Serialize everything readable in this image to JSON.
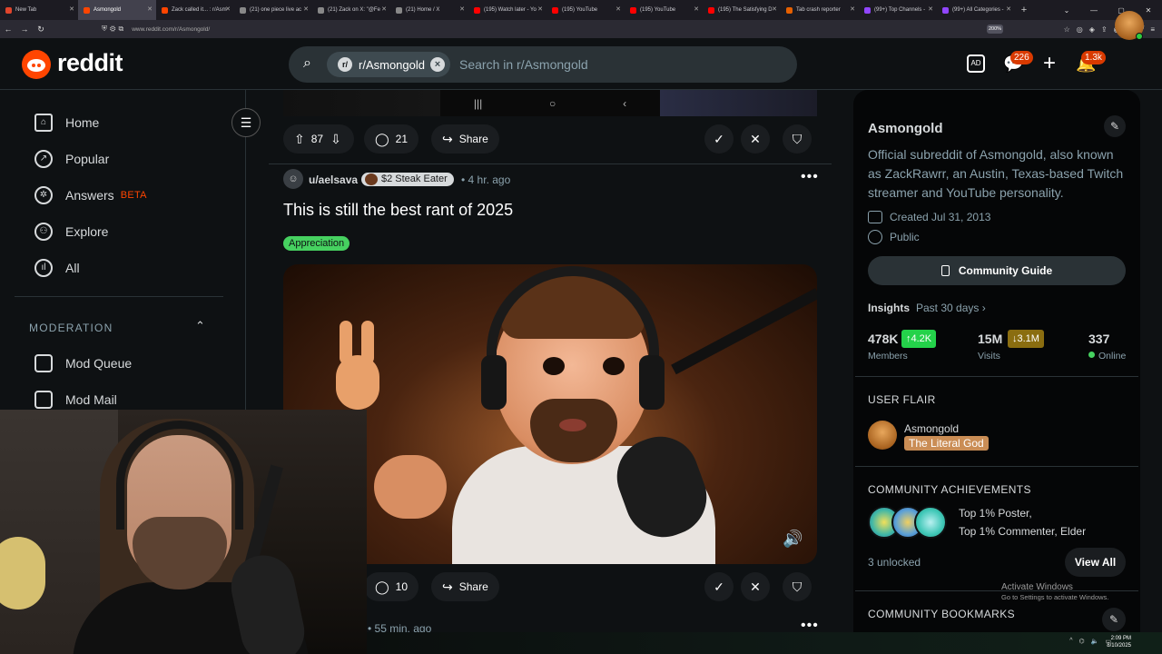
{
  "browser": {
    "tabs": [
      {
        "title": "New Tab",
        "color": "#e0452c"
      },
      {
        "title": "Asmongold",
        "color": "#ff4500"
      },
      {
        "title": "Zack called it... : r/Asm",
        "color": "#ff4500"
      },
      {
        "title": "(21) one piece live ac",
        "color": "#888888"
      },
      {
        "title": "(21) Zack on X: \"@Fe",
        "color": "#888888"
      },
      {
        "title": "(21) Home / X",
        "color": "#888888"
      },
      {
        "title": "(195) Watch later - Yo",
        "color": "#ff0000"
      },
      {
        "title": "(195) YouTube",
        "color": "#ff0000"
      },
      {
        "title": "(195) YouTube",
        "color": "#ff0000"
      },
      {
        "title": "(195) The Satisfying D",
        "color": "#ff0000"
      },
      {
        "title": "Tab crash reporter",
        "color": "#e66000"
      },
      {
        "title": "(99+) Top Channels -",
        "color": "#9146ff"
      },
      {
        "title": "(99+) All Categories -",
        "color": "#9146ff"
      }
    ],
    "url": "www.reddit.com/r/Asmongold/",
    "zoom": "200%"
  },
  "header": {
    "logo_text": "reddit",
    "search_chip": "r/Asmongold",
    "search_placeholder": "Search in r/Asmongold",
    "chat_badge": "226",
    "notif_badge": "1.3k"
  },
  "left_nav": {
    "items": [
      "Home",
      "Popular",
      "Answers",
      "Explore",
      "All"
    ],
    "answers_badge": "BETA",
    "moderation_heading": "MODERATION",
    "mod_items": [
      "Mod Queue",
      "Mod Mail"
    ]
  },
  "feed": {
    "prev_post": {
      "votes": "87",
      "comments": "21",
      "share": "Share"
    },
    "post": {
      "author": "u/aelsava",
      "flair": "$2 Steak Eater",
      "time": "4 hr. ago",
      "title": "This is still the best rant of 2025",
      "tag": "Appreciation",
      "comments": "10",
      "share": "Share"
    },
    "next_post": {
      "time": "• 55 min. ago"
    }
  },
  "community": {
    "name": "Asmongold",
    "description": "Official subreddit of Asmongold, also known as ZackRawrr, an Austin, Texas-based Twitch streamer and YouTube personality.",
    "created": "Created Jul 31, 2013",
    "visibility": "Public",
    "guide_label": "Community Guide",
    "insights_label": "Insights",
    "insights_period": "Past 30 days ›",
    "members": "478K",
    "members_delta": "↑4.2K",
    "members_label": "Members",
    "visits": "15M",
    "visits_delta": "↓3.1M",
    "visits_label": "Visits",
    "online": "337",
    "online_label": "Online",
    "user_flair_heading": "USER FLAIR",
    "flair_user": "Asmongold",
    "flair_tag": "The Literal God",
    "achievements_heading": "COMMUNITY ACHIEVEMENTS",
    "achievements_line1": "Top 1% Poster,",
    "achievements_line2": "Top 1% Commenter, Elder",
    "unlocked": "3 unlocked",
    "view_all": "View All",
    "bookmarks_heading": "COMMUNITY BOOKMARKS"
  },
  "os": {
    "activate_title": "Activate Windows",
    "activate_sub": "Go to Settings to activate Windows.",
    "time": "2:09 PM",
    "date": "8/10/2025"
  },
  "colors": {
    "accent": "#ff4500",
    "positive_chip": "#24d24a",
    "negative_chip": "#8a6d10",
    "tag_green": "#46d160"
  }
}
